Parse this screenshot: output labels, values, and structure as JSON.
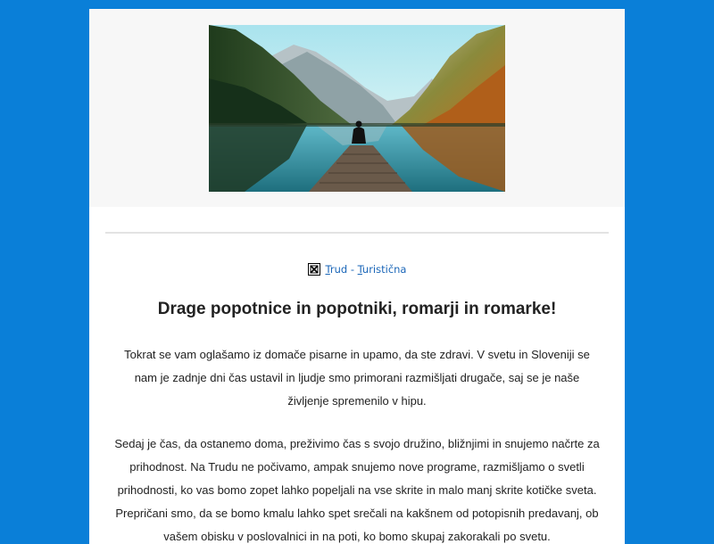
{
  "email": {
    "hero_image": {
      "alt": "Oseba sedi na pomolu ob jezeru med gorami"
    },
    "logo_link": {
      "prefix": "T",
      "text": "rud - ",
      "t2": "T",
      "rest": "uristična",
      "full": "Trud - Turistična"
    },
    "headline": "Drage popotnice in popotniki, romarji in romarke!",
    "paragraphs": [
      "Tokrat se vam oglašamo iz domače pisarne in upamo, da ste zdravi. V svetu in Sloveniji se nam je zadnje dni čas ustavil in ljudje smo primorani razmišljati drugače, saj se je naše življenje spremenilo v hipu.",
      "Sedaj je čas, da ostanemo doma, preživimo čas s svojo družino, bližnjimi in snujemo načrte za prihodnost. Na Trudu ne počivamo, ampak snujemo nove programe, razmišljamo o svetli prihodnosti, ko vas bomo zopet lahko popeljali na vse skrite in malo manj skrite kotičke sveta.",
      "Prepričani smo, da se bomo kmalu lahko spet srečali na kakšnem od potopisnih predavanj, ob vašem obisku v poslovalnici in na poti, ko bomo skupaj zakorakali po svetu."
    ]
  },
  "colors": {
    "page_background": "#0a7fd8",
    "header_background": "#f7f7f7",
    "link": "#1a66b8",
    "text": "#222222"
  }
}
